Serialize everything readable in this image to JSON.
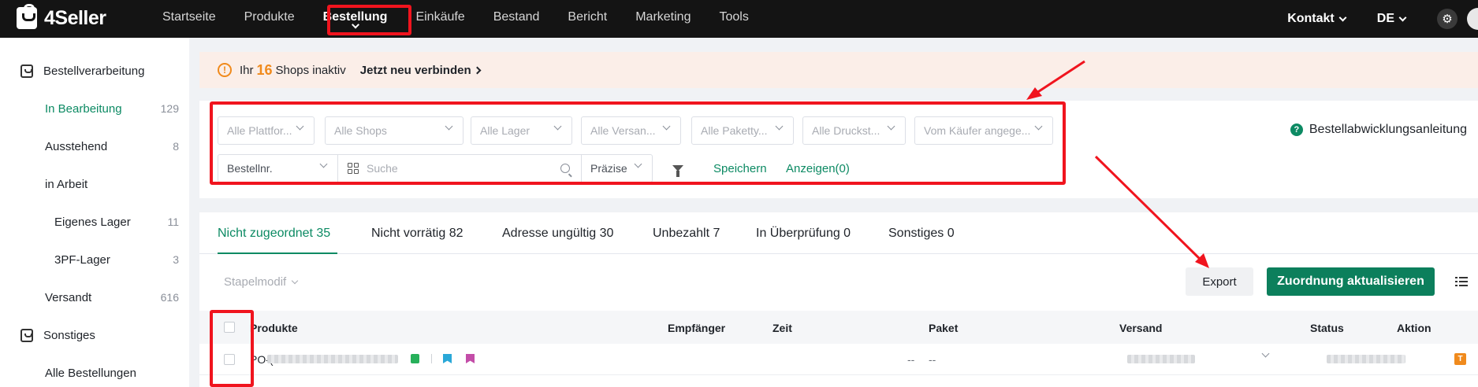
{
  "app": {
    "name": "4Seller"
  },
  "nav": {
    "items": [
      "Startseite",
      "Produkte",
      "Bestellung",
      "Einkäufe",
      "Bestand",
      "Bericht",
      "Marketing",
      "Tools"
    ],
    "contact": "Kontakt",
    "language": "DE"
  },
  "sidebar": {
    "group1": "Bestellverarbeitung",
    "items": [
      {
        "label": "In Bearbeitung",
        "count": "129"
      },
      {
        "label": "Ausstehend",
        "count": "8"
      },
      {
        "label": "in Arbeit",
        "count": ""
      },
      {
        "label": "Eigenes Lager",
        "count": "11"
      },
      {
        "label": "3PF-Lager",
        "count": "3"
      },
      {
        "label": "Versandt",
        "count": "616"
      }
    ],
    "group2": "Sonstiges",
    "all_orders": "Alle Bestellungen"
  },
  "banner": {
    "prefix": "Ihr",
    "count": "16",
    "suffix": "Shops inaktiv",
    "link": "Jetzt neu verbinden"
  },
  "filters": {
    "platform": "Alle Plattfor...",
    "shops": "Alle Shops",
    "warehouse": "Alle Lager",
    "shipping": "Alle Versan...",
    "package": "Alle Paketty...",
    "print": "Alle Druckst...",
    "buyer": "Vom Käufer angege...",
    "order_no": "Bestellnr.",
    "search_placeholder": "Suche",
    "precision": "Präzise",
    "save": "Speichern",
    "show": "Anzeigen(0)",
    "guide": "Bestellabwicklungsanleitung"
  },
  "tabs": [
    "Nicht zugeordnet 35",
    "Nicht vorrätig 82",
    "Adresse ungültig 30",
    "Unbezahlt 7",
    "In Überprüfung 0",
    "Sonstiges 0"
  ],
  "toolbar": {
    "bulk": "Stapelmodif",
    "export": "Export",
    "update": "Zuordnung aktualisieren"
  },
  "table": {
    "headers": [
      "Produkte",
      "Empfänger",
      "Zeit",
      "Paket",
      "Versand",
      "Status",
      "Aktion"
    ],
    "row": {
      "order_prefix": "PO-(",
      "recipient": "--",
      "package": "--",
      "badge": "T"
    }
  }
}
